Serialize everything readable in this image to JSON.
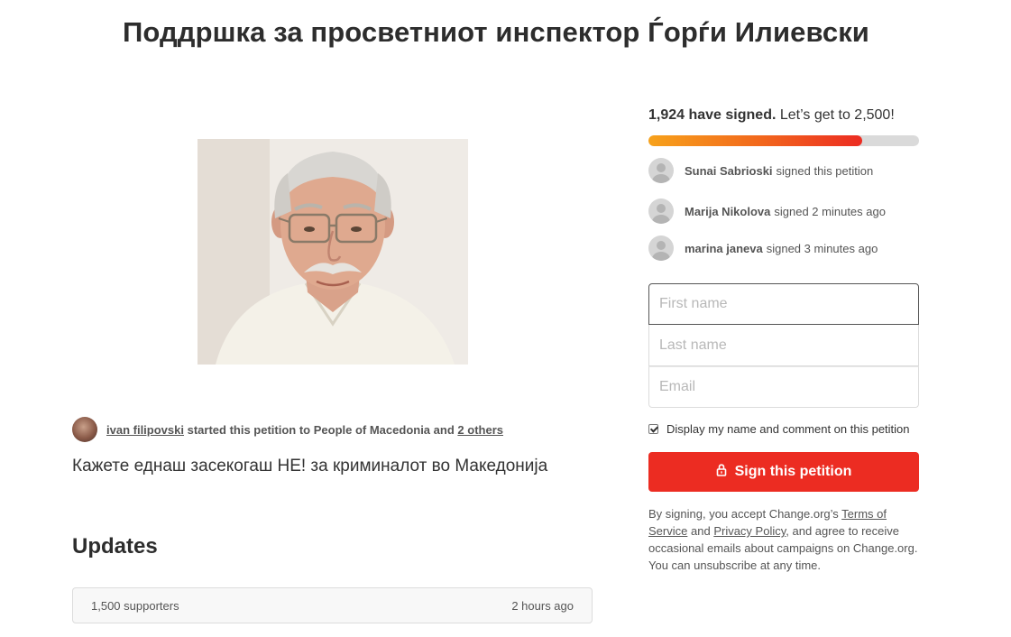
{
  "page": {
    "title": "Поддршка за просветниот инспектор Ѓорѓи Илиевски"
  },
  "petition": {
    "photo_icon": "portrait-photo",
    "starter": {
      "name": "ivan filipovski",
      "middle_text": "started this petition to",
      "recipient": "People of Macedonia",
      "and_text": "and",
      "others": "2 others"
    },
    "description": "Кажете еднаш засекогаш НЕ! за криминалот во Македонија"
  },
  "updates": {
    "heading": "Updates",
    "items": [
      {
        "label": "1,500 supporters",
        "time": "2 hours ago"
      }
    ]
  },
  "signatures": {
    "count_bold": "1,924 have signed.",
    "goal_text": "Let’s get to 2,500!",
    "progress_fraction": 0.79,
    "recent": [
      {
        "name": "Sunai Sabrioski",
        "action": "signed this petition"
      },
      {
        "name": "Marija Nikolova",
        "action": "signed 2 minutes ago"
      },
      {
        "name": "marina janeva",
        "action": "signed 3 minutes ago"
      }
    ]
  },
  "form": {
    "first_name_placeholder": "First name",
    "last_name_placeholder": "Last name",
    "email_placeholder": "Email",
    "display_consent_label": "Display my name and comment on this petition",
    "display_consent_checked": true,
    "sign_button_label": "Sign this petition",
    "sign_button_icon": "lock-icon",
    "legal": {
      "part1": "By signing, you accept Change.org’s",
      "terms_link": "Terms of Service",
      "part2": "and",
      "privacy_link": "Privacy Policy",
      "part3": ", and agree to receive occasional emails about campaigns on Change.org. You can unsubscribe at any time."
    }
  },
  "colors": {
    "brand_red": "#ec2c22",
    "progress_start": "#f7a21b",
    "progress_end": "#ec2c22",
    "progress_track": "#dadada"
  }
}
